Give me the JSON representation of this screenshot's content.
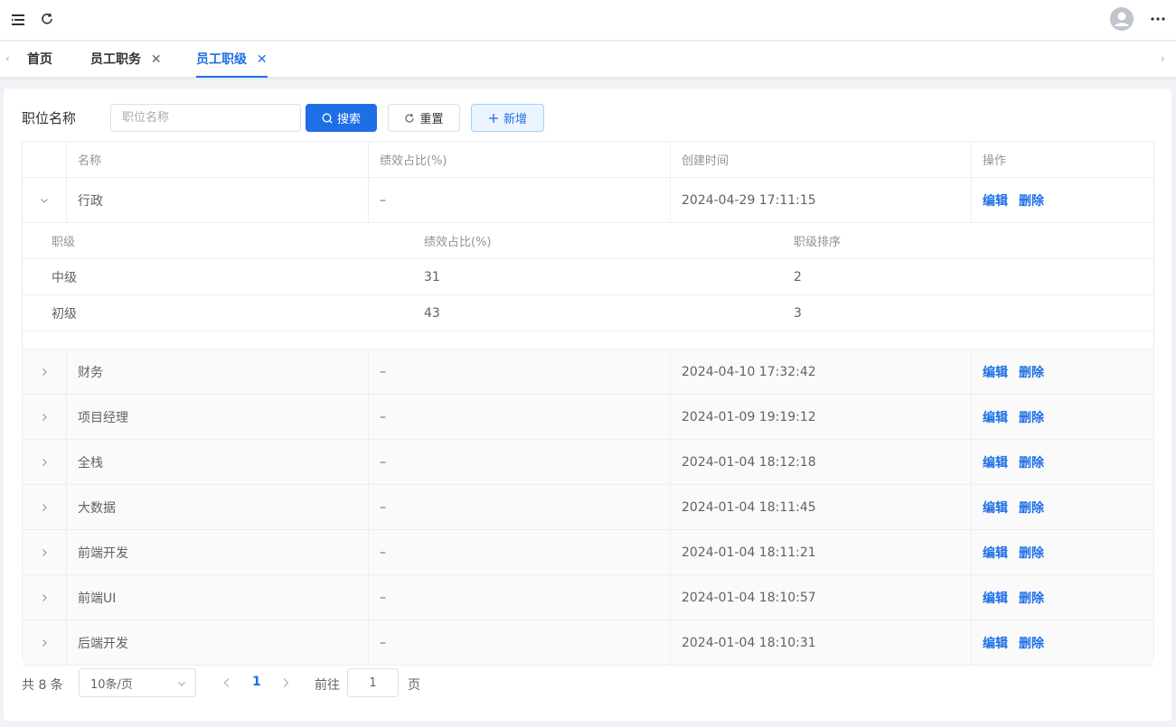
{
  "tabs": [
    {
      "label": "首页",
      "closable": false,
      "active": false
    },
    {
      "label": "员工职务",
      "closable": true,
      "active": false
    },
    {
      "label": "员工职级",
      "closable": true,
      "active": true
    }
  ],
  "tab_close_glyph": "✕",
  "filter": {
    "label": "职位名称",
    "placeholder": "职位名称",
    "value": "",
    "search_label": "搜索",
    "reset_label": "重置",
    "add_label": "新增"
  },
  "table": {
    "columns": [
      "名称",
      "绩效占比(%)",
      "创建时间",
      "操作"
    ],
    "action_edit": "编辑",
    "action_delete": "删除",
    "rows": [
      {
        "name": "行政",
        "ratio": "–",
        "created": "2024-04-29 17:11:15",
        "expanded": true
      },
      {
        "name": "财务",
        "ratio": "–",
        "created": "2024-04-10 17:32:42",
        "expanded": false
      },
      {
        "name": "项目经理",
        "ratio": "–",
        "created": "2024-01-09 19:19:12",
        "expanded": false
      },
      {
        "name": "全栈",
        "ratio": "–",
        "created": "2024-01-04 18:12:18",
        "expanded": false
      },
      {
        "name": "大数据",
        "ratio": "–",
        "created": "2024-01-04 18:11:45",
        "expanded": false
      },
      {
        "name": "前端开发",
        "ratio": "–",
        "created": "2024-01-04 18:11:21",
        "expanded": false
      },
      {
        "name": "前端UI",
        "ratio": "–",
        "created": "2024-01-04 18:10:57",
        "expanded": false
      },
      {
        "name": "后端开发",
        "ratio": "–",
        "created": "2024-01-04 18:10:31",
        "expanded": false
      }
    ],
    "sub_table": {
      "columns": [
        "职级",
        "绩效占比(%)",
        "职级排序"
      ],
      "rows": [
        {
          "level": "中级",
          "ratio": "31",
          "order": "2"
        },
        {
          "level": "初级",
          "ratio": "43",
          "order": "3"
        }
      ]
    }
  },
  "pagination": {
    "total_text": "共 8 条",
    "page_size": "10条/页",
    "current_page": "1",
    "goto_label": "前往",
    "goto_value": "1",
    "page_unit": "页"
  },
  "icons": {
    "menu": "hamburger-icon",
    "refresh": "refresh-icon",
    "user": "avatar-icon",
    "more": "more-icon",
    "search": "search-icon",
    "reset": "reset-icon",
    "add": "plus-icon",
    "expand": "chevron-icon"
  },
  "colors": {
    "primary": "#1e6fe6",
    "text": "#303133",
    "muted": "#909399",
    "border": "#ebeef5"
  }
}
